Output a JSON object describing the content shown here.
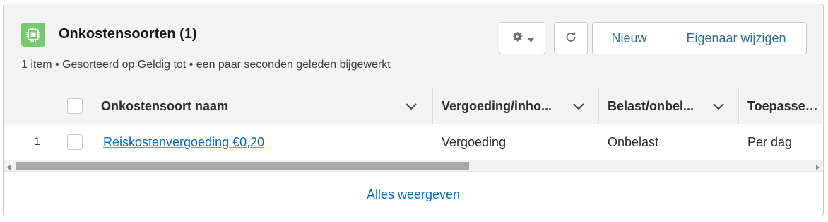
{
  "header": {
    "title": "Onkostensoorten (1)",
    "subtitle": "1 item • Gesorteerd op Geldig tot • een paar seconden geleden bijgewerkt",
    "icon": "chip-icon",
    "icon_color": "#76c96e"
  },
  "actions": {
    "settings_icon": "gear-icon",
    "refresh_icon": "refresh-icon",
    "new_label": "Nieuw",
    "change_owner_label": "Eigenaar wijzigen"
  },
  "table": {
    "columns": [
      {
        "label": "Onkostensoort naam"
      },
      {
        "label": "Vergoeding/inho..."
      },
      {
        "label": "Belast/onbel..."
      },
      {
        "label": "Toepassen ..."
      }
    ],
    "rows": [
      {
        "num": "1",
        "name": "Reiskostenvergoeding €0,20",
        "type": "Vergoeding",
        "tax": "Onbelast",
        "apply": "Per dag"
      }
    ]
  },
  "footer": {
    "view_all_label": "Alles weergeven"
  },
  "colors": {
    "link": "#0b6bb5",
    "header_bg": "#f3f3f3",
    "button_text": "#2f6d8f"
  }
}
